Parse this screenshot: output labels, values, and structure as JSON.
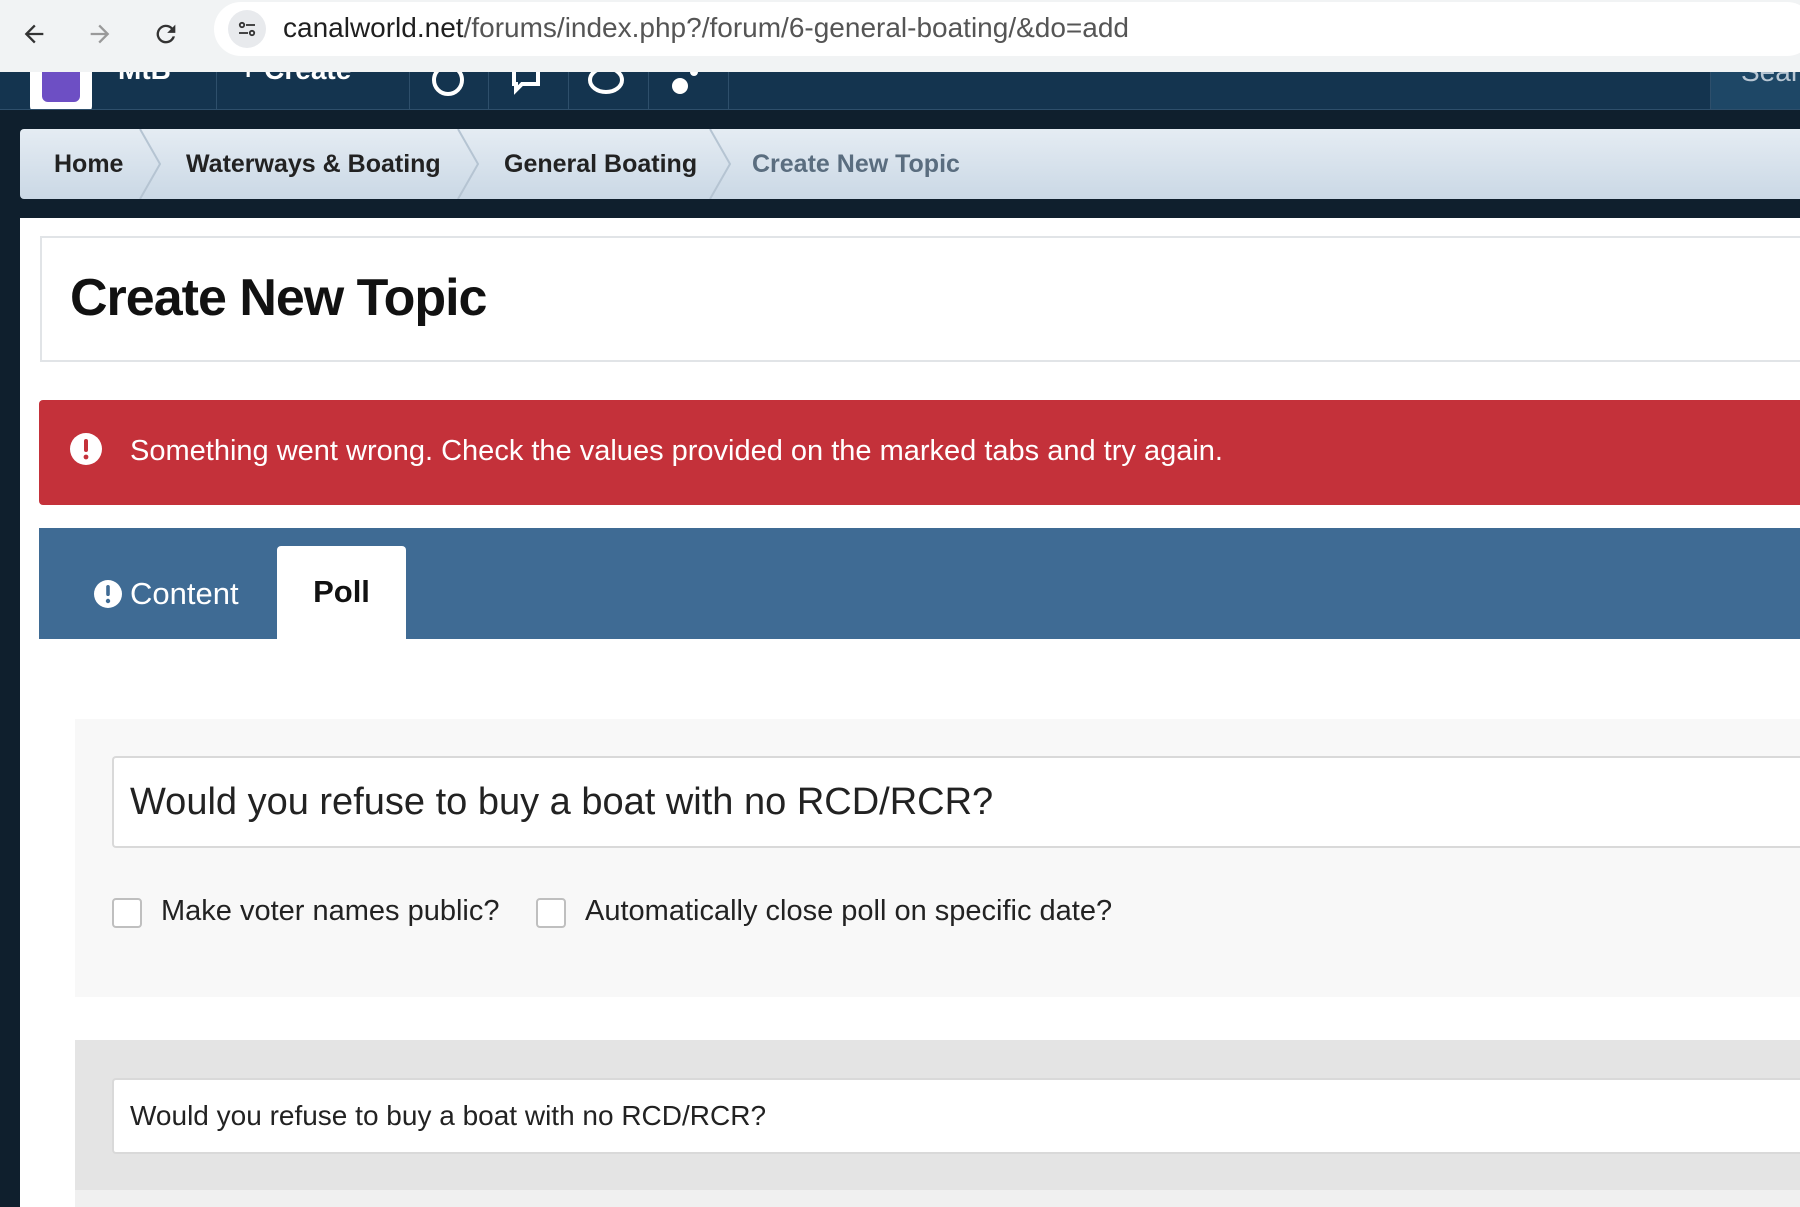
{
  "browser": {
    "url_host": "canalworld.net",
    "url_path": "/forums/index.php?/forum/6-general-boating/&do=add"
  },
  "site_nav": {
    "account_label": "MtB",
    "create_label": "+ Create",
    "search_label": "Sear"
  },
  "breadcrumb": [
    "Home",
    "Waterways & Boating",
    "General Boating",
    "Create New Topic"
  ],
  "page": {
    "title": "Create New Topic"
  },
  "error": {
    "message": "Something went wrong. Check the values provided on the marked tabs and try again.",
    "color": "#c4313a"
  },
  "tabs": [
    {
      "label": "Content",
      "icon": "exclamation-circle-icon",
      "active": false
    },
    {
      "label": "Poll",
      "active": true
    }
  ],
  "poll": {
    "title_value": "Would you refuse to buy a boat with no RCD/RCR?",
    "public_voters_label": "Make voter names public?",
    "public_voters_checked": false,
    "auto_close_label": "Automatically close poll on specific date?",
    "auto_close_checked": false,
    "question_value": "Would you refuse to buy a boat with no RCD/RCR?"
  },
  "colors": {
    "tab_bar": "#3f6b94",
    "site_header": "#14344f"
  }
}
